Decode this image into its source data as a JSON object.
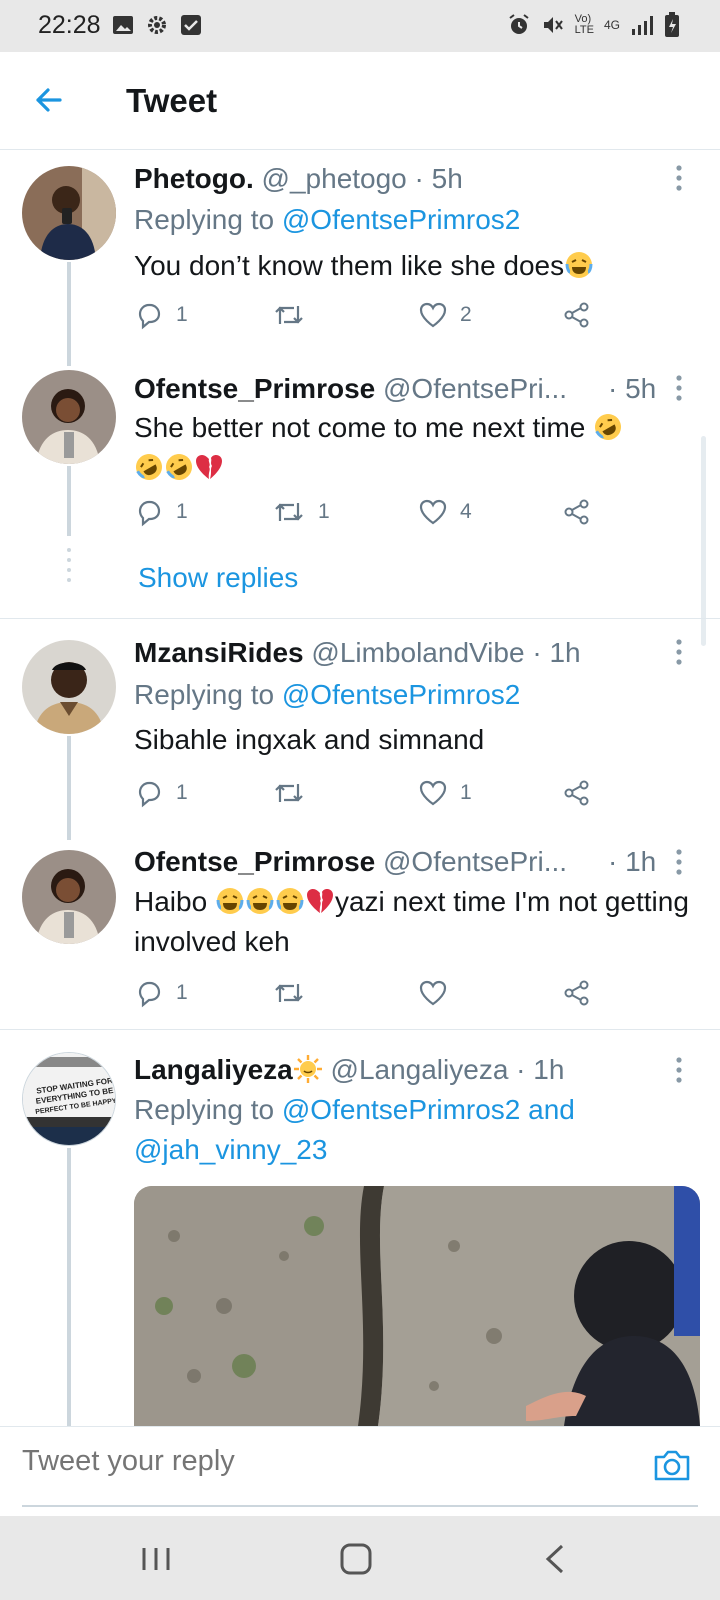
{
  "status_bar": {
    "time": "22:28",
    "left_icons": [
      "image-icon",
      "gear-icon",
      "checkbox-icon"
    ],
    "right_icons": [
      "alarm-icon",
      "mute-icon",
      "volte-icon",
      "4g-icon",
      "signal-icon",
      "battery-icon"
    ],
    "volte_label_top": "Vo)",
    "volte_label_bottom": "LTE",
    "network_label": "4G"
  },
  "header": {
    "title": "Tweet"
  },
  "colors": {
    "accent": "#1b95e0",
    "secondary_text": "#657786",
    "heart_emoji": "#e0245e",
    "thread_line": "#ccd6dd"
  },
  "tweets": [
    {
      "name": "Phetogo.",
      "handle": "@_phetogo",
      "time": "· 5h",
      "reply_prefix": "Replying to",
      "reply_to": "@OfentsePrimros2",
      "text": "You don’t know them like she does",
      "emojis": [
        "joy"
      ],
      "replies": "1",
      "retweets": "",
      "likes": "2"
    },
    {
      "name": "Ofentse_Primrose",
      "handle": "@OfentsePri...",
      "time": "· 5h",
      "text": "She better not come to me next time",
      "emojis": [
        "rofl",
        "rofl",
        "rofl",
        "broken-heart"
      ],
      "replies": "1",
      "retweets": "1",
      "likes": "4"
    },
    {
      "name": "MzansiRides",
      "handle": "@LimbolandVibe",
      "time": "· 1h",
      "reply_prefix": "Replying to",
      "reply_to": "@OfentsePrimros2",
      "text": "Sibahle ingxak and simnand",
      "replies": "1",
      "retweets": "",
      "likes": "1"
    },
    {
      "name": "Ofentse_Primrose",
      "handle": "@OfentsePri...",
      "time": "· 1h",
      "text_prefix": "Haibo",
      "text": "yazi next time I'm not getting involved keh",
      "emojis": [
        "joy",
        "joy",
        "joy",
        "broken-heart"
      ],
      "replies": "1",
      "retweets": "",
      "likes": ""
    },
    {
      "name": "Langaliyeza",
      "handle": "@Langaliyeza",
      "time": "· 1h",
      "emojis": [
        "sun"
      ],
      "reply_prefix": "Replying to",
      "reply_to": "@OfentsePrimros2 and",
      "reply_to_2": "@jah_vinny_23",
      "avatar_sign": [
        "STOP WAITING FOR",
        "EVERYTHING TO BE",
        "PERFECT TO BE HAPPY"
      ]
    }
  ],
  "show_replies": "Show replies",
  "reply_bar": {
    "placeholder": "Tweet your reply"
  },
  "nav_bar": {
    "buttons": [
      "recents-button",
      "home-button",
      "back-button"
    ]
  }
}
